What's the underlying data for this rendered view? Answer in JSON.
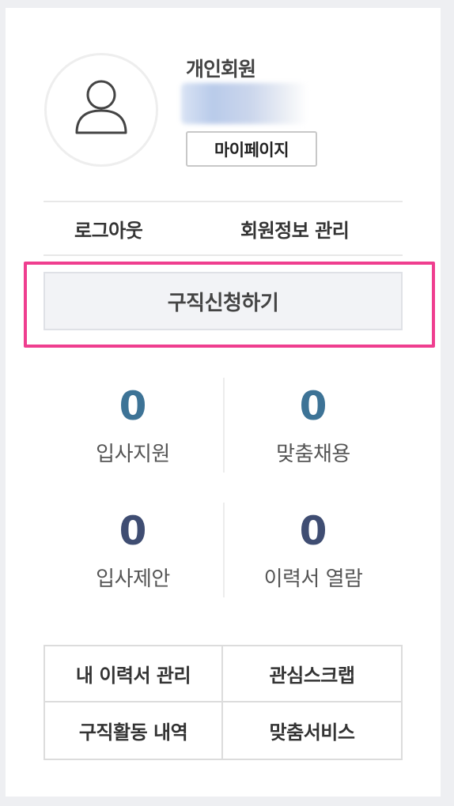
{
  "profile": {
    "member_type": "개인회원",
    "mypage_label": "마이페이지"
  },
  "account_links": {
    "logout": "로그아웃",
    "member_info": "회원정보 관리"
  },
  "apply_button": "구직신청하기",
  "stats": [
    {
      "value": "0",
      "label": "입사지원",
      "color": "#3d7396"
    },
    {
      "value": "0",
      "label": "맞춤채용",
      "color": "#3d7396"
    },
    {
      "value": "0",
      "label": "입사제안",
      "color": "#3f4d72"
    },
    {
      "value": "0",
      "label": "이력서 열람",
      "color": "#3f4d72"
    }
  ],
  "menu": [
    "내 이력서 관리",
    "관심스크랩",
    "구직활동 내역",
    "맞춤서비스"
  ],
  "colors": {
    "highlight": "#ef3e8f",
    "stat_primary": "#3d7396",
    "stat_secondary": "#3f4d72"
  }
}
